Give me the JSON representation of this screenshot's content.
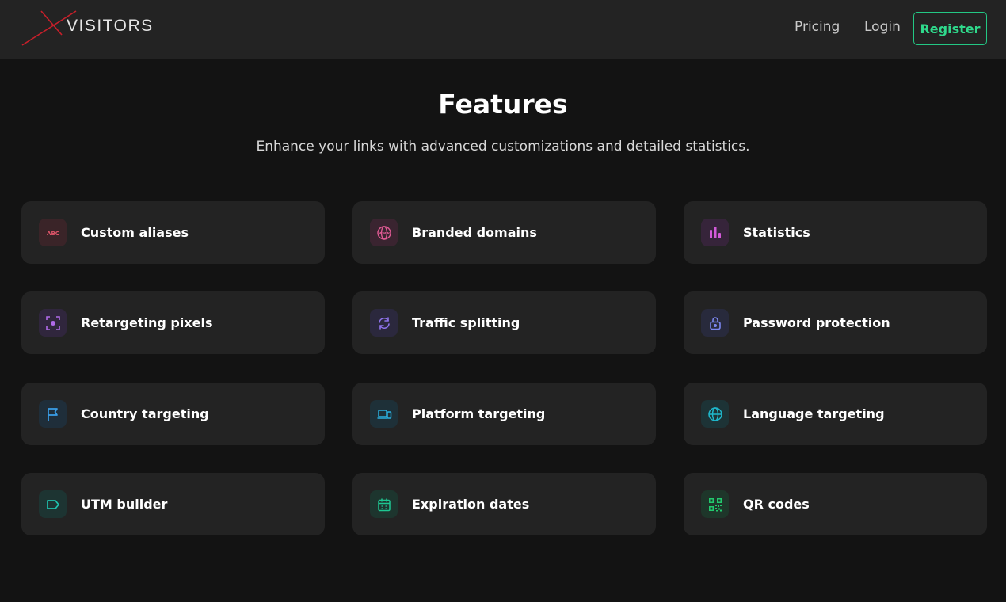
{
  "header": {
    "logo_text": "VISITORS",
    "nav": [
      {
        "label": "Pricing"
      },
      {
        "label": "Login"
      }
    ],
    "register_label": "Register"
  },
  "hero": {
    "title": "Features",
    "subtitle": "Enhance your links with advanced customizations and detailed statistics."
  },
  "features": [
    {
      "label": "Custom aliases",
      "icon": "abc-icon",
      "icon_text": "ABC",
      "color": "#e0556a",
      "bg": "#3a2428"
    },
    {
      "label": "Branded domains",
      "icon": "www-globe-icon",
      "icon_text": "www",
      "color": "#e05a94",
      "bg": "#3a2430"
    },
    {
      "label": "Statistics",
      "icon": "bar-chart-icon",
      "color": "#d35ad8",
      "bg": "#36243a"
    },
    {
      "label": "Retargeting pixels",
      "icon": "target-icon",
      "color": "#b06ae8",
      "bg": "#30263d"
    },
    {
      "label": "Traffic splitting",
      "icon": "refresh-icon",
      "color": "#8f73ea",
      "bg": "#2b283d"
    },
    {
      "label": "Password protection",
      "icon": "lock-icon",
      "color": "#7b86ee",
      "bg": "#282a3c"
    },
    {
      "label": "Country targeting",
      "icon": "flag-icon",
      "color": "#3a9ee8",
      "bg": "#1f2e3a"
    },
    {
      "label": "Platform targeting",
      "icon": "devices-icon",
      "color": "#2ab0e0",
      "bg": "#1e3038"
    },
    {
      "label": "Language targeting",
      "icon": "globe-icon",
      "color": "#1fb8cc",
      "bg": "#1d3336"
    },
    {
      "label": "UTM builder",
      "icon": "tag-icon",
      "color": "#1fc2ae",
      "bg": "#1d3432"
    },
    {
      "label": "Expiration dates",
      "icon": "calendar-icon",
      "color": "#1ec792",
      "bg": "#1d352e"
    },
    {
      "label": "QR codes",
      "icon": "qr-code-icon",
      "color": "#22c96d",
      "bg": "#1e362a"
    }
  ]
}
